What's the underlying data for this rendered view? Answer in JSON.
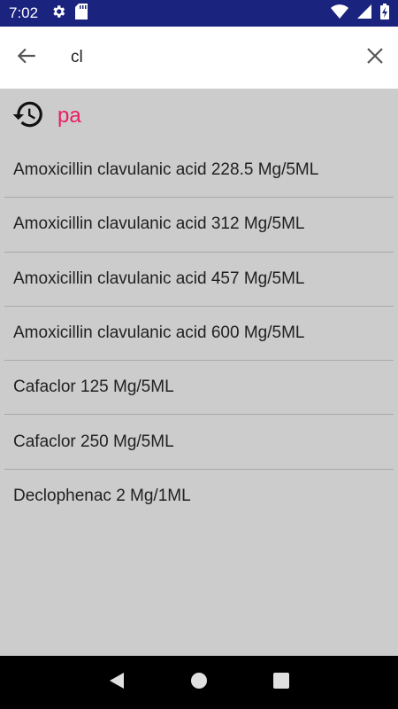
{
  "status_bar": {
    "time": "7:02",
    "left_icons": [
      "gear-icon",
      "sd-card-icon"
    ],
    "right_icons": [
      "wifi-icon",
      "signal-icon",
      "battery-charging-icon"
    ],
    "background": "#1a237e"
  },
  "search": {
    "value": "cl",
    "back_icon": "arrow-left-icon",
    "clear_icon": "close-icon"
  },
  "history": {
    "icon": "history-icon",
    "text": "pa",
    "color": "#e91e63"
  },
  "results": [
    "Amoxicillin clavulanic acid 228.5 Mg/5ML",
    "Amoxicillin clavulanic acid 312 Mg/5ML",
    "Amoxicillin clavulanic acid 457 Mg/5ML",
    "Amoxicillin clavulanic acid 600 Mg/5ML",
    "Cafaclor 125 Mg/5ML",
    "Cafaclor 250 Mg/5ML",
    "Declophenac 2 Mg/1ML"
  ],
  "nav_bar": {
    "icons": [
      "back-triangle-icon",
      "home-circle-icon",
      "recents-square-icon"
    ]
  }
}
